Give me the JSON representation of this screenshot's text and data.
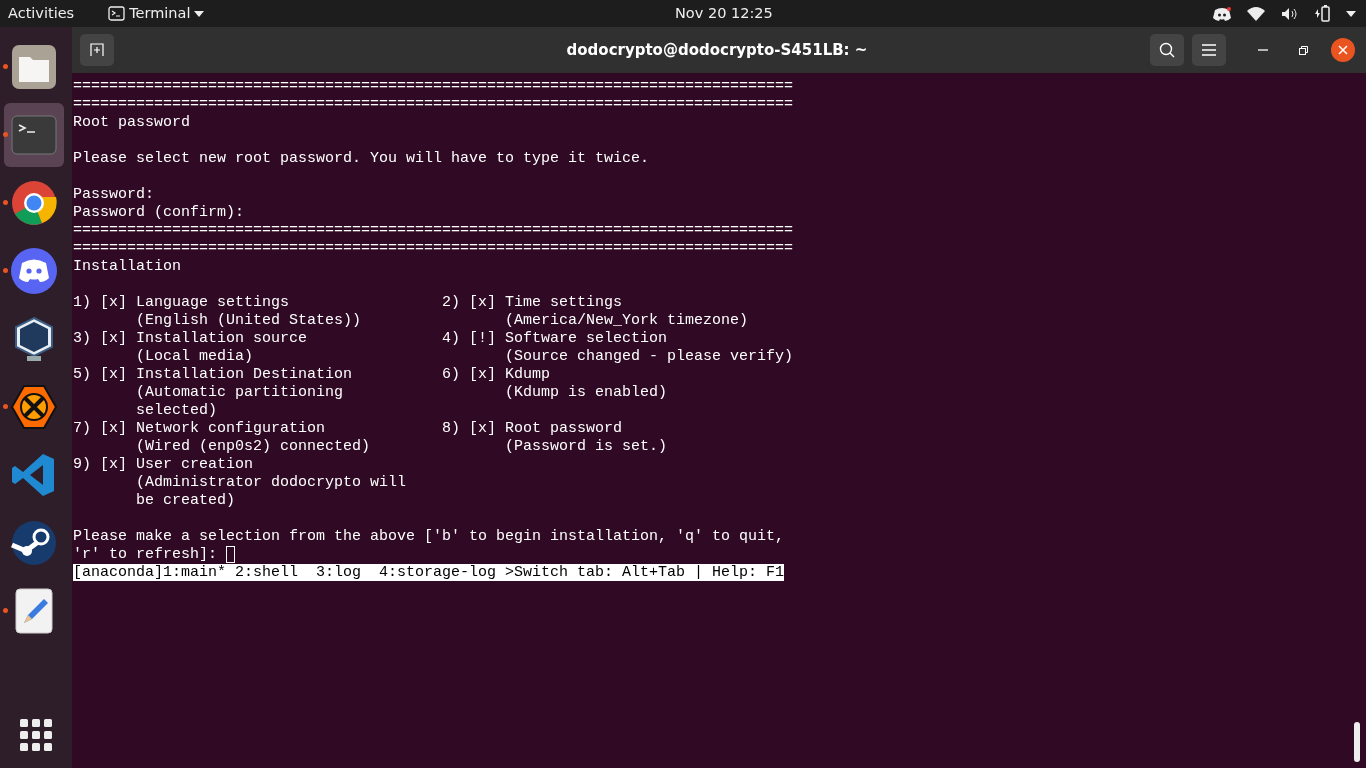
{
  "top_bar": {
    "activities": "Activities",
    "app_menu": "Terminal",
    "clock": "Nov 20  12:25"
  },
  "dock": [
    {
      "kind": "files",
      "running": true,
      "selected": false
    },
    {
      "kind": "terminal",
      "running": true,
      "selected": true
    },
    {
      "kind": "chrome",
      "running": true,
      "selected": false
    },
    {
      "kind": "discord",
      "running": true,
      "selected": false
    },
    {
      "kind": "virtualbox",
      "running": false,
      "selected": false
    },
    {
      "kind": "xampp",
      "running": true,
      "selected": false
    },
    {
      "kind": "vscode",
      "running": false,
      "selected": false
    },
    {
      "kind": "steam",
      "running": false,
      "selected": false
    },
    {
      "kind": "editor",
      "running": true,
      "selected": false
    }
  ],
  "window": {
    "title": "dodocrypto@dodocrypto-S451LB: ~"
  },
  "terminal": {
    "lines": [
      {
        "kind": "text",
        "text": "================================================================================"
      },
      {
        "kind": "text",
        "text": "================================================================================"
      },
      {
        "kind": "text",
        "text": "Root password"
      },
      {
        "kind": "blank"
      },
      {
        "kind": "text",
        "text": "Please select new root password. You will have to type it twice."
      },
      {
        "kind": "blank"
      },
      {
        "kind": "text",
        "text": "Password:"
      },
      {
        "kind": "text",
        "text": "Password (confirm):"
      },
      {
        "kind": "text",
        "text": "================================================================================"
      },
      {
        "kind": "text",
        "text": "================================================================================"
      },
      {
        "kind": "text",
        "text": "Installation"
      },
      {
        "kind": "blank"
      },
      {
        "kind": "columns",
        "left": "1) [x] Language settings",
        "right": "2) [x] Time settings"
      },
      {
        "kind": "columns",
        "left": "       (English (United States))",
        "right": "       (America/New_York timezone)"
      },
      {
        "kind": "columns",
        "left": "3) [x] Installation source",
        "right": "4) [!] Software selection"
      },
      {
        "kind": "columns",
        "left": "       (Local media)",
        "right": "       (Source changed - please verify)"
      },
      {
        "kind": "columns",
        "left": "5) [x] Installation Destination",
        "right": "6) [x] Kdump"
      },
      {
        "kind": "columns",
        "left": "       (Automatic partitioning",
        "right": "       (Kdump is enabled)"
      },
      {
        "kind": "text",
        "text": "       selected)"
      },
      {
        "kind": "columns",
        "left": "7) [x] Network configuration",
        "right": "8) [x] Root password"
      },
      {
        "kind": "columns",
        "left": "       (Wired (enp0s2) connected)",
        "right": "       (Password is set.)"
      },
      {
        "kind": "text",
        "text": "9) [x] User creation"
      },
      {
        "kind": "text",
        "text": "       (Administrator dodocrypto will"
      },
      {
        "kind": "text",
        "text": "       be created)"
      },
      {
        "kind": "blank"
      },
      {
        "kind": "text",
        "text": "Please make a selection from the above ['b' to begin installation, 'q' to quit,"
      },
      {
        "kind": "prompt",
        "text": "'r' to refresh]: "
      },
      {
        "kind": "status",
        "text": "[anaconda]1:main* 2:shell  3:log  4:storage-log >Switch tab: Alt+Tab | Help: F1"
      }
    ]
  }
}
